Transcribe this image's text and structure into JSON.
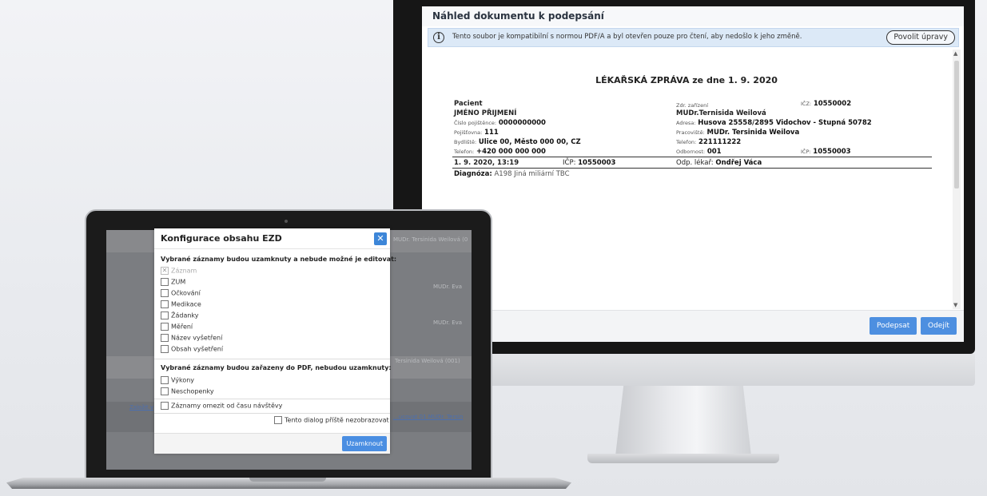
{
  "monitor": {
    "title": "Náhled dokumentu k podepsání",
    "notice": {
      "icon": "info-icon",
      "message": "Tento soubor je kompatibilní s normou PDF/A a byl otevřen pouze pro čtení, aby nedošlo k jeho změně.",
      "button": "Povolit úpravy"
    },
    "report": {
      "title": "LÉKAŘSKÁ ZPRÁVA ze dne 1. 9. 2020",
      "patient_label": "Pacient",
      "patient_name": "JMÉNO PŘIJMENÍ",
      "insurance_no_label": "Číslo pojištěnce:",
      "insurance_no": "0000000000",
      "insurer_label": "Pojišťovna:",
      "insurer": "111",
      "residence_label": "Bydliště:",
      "residence": "Ulice 00, Město 000 00, CZ",
      "phone_label": "Telefon:",
      "phone": "+420 000 000 000",
      "facility_label": "Zdr. zařízení",
      "ico_label": "IČZ:",
      "ico": "10550002",
      "doctor": "MUDr.Ternisida Weilová",
      "address_label": "Adresa:",
      "address": "Husova 25558/2895 Vidochov - Stupná 50782",
      "workplace_label": "Pracoviště:",
      "workplace": "MUDr. Tersinida Weilova",
      "facility_phone_label": "Telefon:",
      "facility_phone": "221111222",
      "specialty_label": "Odbornost:",
      "specialty": "001",
      "icp_label": "IČP:",
      "icp": "10550003",
      "datetime": "1. 9. 2020, 13:19",
      "icp2_label": "IČP:",
      "icp2": "10550003",
      "resp_doctor_label": "Odp. lékař:",
      "resp_doctor": "Ondřej Váca",
      "diagnosis_label": "Diagnóza:",
      "diagnosis": "A198 Jiná miliární TBC"
    },
    "buttons": {
      "sign": "Podepsat",
      "leave": "Odejít"
    }
  },
  "laptop": {
    "background": {
      "text1": "MUDr. Tersinida Weilová (0",
      "text2": "MUDr. Eva",
      "text3": "MUDr. Eva",
      "text4": "Tersinida Weilová (001)",
      "text5": "Založit v",
      "text6": "...ucovat 01 MUDr. Tersin"
    },
    "dialog": {
      "title": "Konfigurace obsahu EZD",
      "close_icon": "close-icon",
      "section1": "Vybrané záznamy budou uzamknuty a nebude možné je editovat:",
      "locked_items": [
        "Záznam",
        "ZUM",
        "Očkování",
        "Medikace",
        "Žádanky",
        "Měření",
        "Název vyšetření",
        "Obsah vyšetření"
      ],
      "section2": "Vybrané záznamy budou zařazeny do PDF, nebudou uzamknuty:",
      "pdf_items": [
        "Výkony",
        "Neschopenky"
      ],
      "limit_label": "Záznamy omezit od času návštěvy",
      "dont_show_label": "Tento dialog příště nezobrazovat",
      "lock_button": "Uzamknout"
    }
  }
}
